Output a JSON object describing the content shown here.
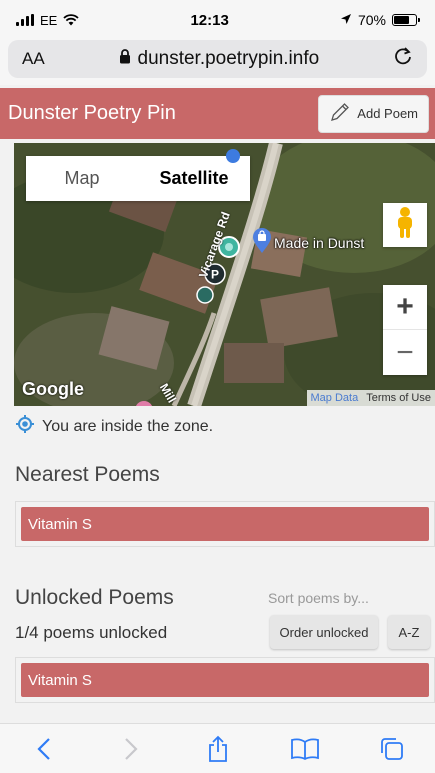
{
  "status_bar": {
    "carrier": "EE",
    "time": "12:13",
    "battery": "70%",
    "battery_level": 0.7
  },
  "browser": {
    "text_size_label": "AA",
    "url": "dunster.poetrypin.info"
  },
  "header": {
    "title": "Dunster Poetry Pin",
    "add_poem_label": "Add Poem"
  },
  "map": {
    "type_options": [
      "Map",
      "Satellite"
    ],
    "selected_type": "Satellite",
    "place_label": "Made in Dunst",
    "road_labels": [
      "Vicarage Rd",
      "Mill"
    ],
    "zoom_in": "+",
    "zoom_out": "−",
    "logo": "Google",
    "map_data_link": "Map Data",
    "terms_link": "Terms of Use"
  },
  "zone_status": "You are inside the zone.",
  "nearest": {
    "title": "Nearest Poems",
    "items": [
      "Vitamin S"
    ]
  },
  "unlocked": {
    "title": "Unlocked Poems",
    "count_text": "1/4 poems unlocked",
    "sort_label": "Sort poems by...",
    "sort_options": [
      "Order unlocked",
      "A-Z"
    ],
    "items": [
      "Vitamin S"
    ]
  },
  "colors": {
    "accent": "#c86868",
    "zone_icon": "#3a8fd6"
  },
  "toolbar": {
    "icons": [
      "back-icon",
      "forward-icon",
      "share-icon",
      "bookmarks-icon",
      "tabs-icon"
    ]
  }
}
